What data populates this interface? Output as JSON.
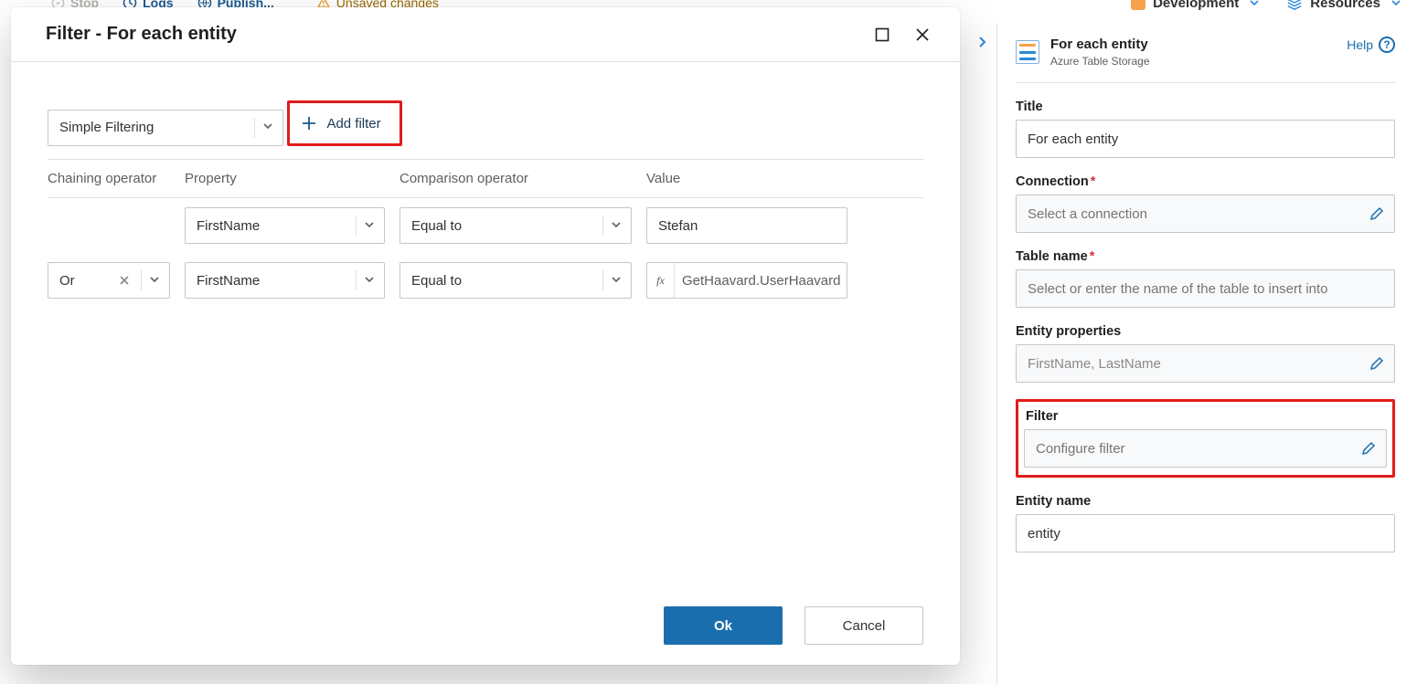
{
  "toolbar": {
    "stop": "Stop",
    "logs": "Logs",
    "publish": "Publish...",
    "unsaved": "Unsaved changes"
  },
  "header": {
    "development": "Development",
    "resources": "Resources"
  },
  "modal": {
    "title": "Filter - For each entity",
    "mode": "Simple Filtering",
    "add_filter": "Add filter",
    "columns": {
      "chain": "Chaining operator",
      "property": "Property",
      "comparison": "Comparison operator",
      "value": "Value"
    },
    "rows": [
      {
        "chain": "",
        "property": "FirstName",
        "comparison": "Equal to",
        "value_type": "text",
        "value": "Stefan"
      },
      {
        "chain": "Or",
        "property": "FirstName",
        "comparison": "Equal to",
        "value_type": "fx",
        "value": "GetHaavard.UserHaavard"
      }
    ],
    "ok": "Ok",
    "cancel": "Cancel"
  },
  "side": {
    "title": "For each entity",
    "subtitle": "Azure Table Storage",
    "help": "Help",
    "fields": {
      "title_label": "Title",
      "title_value": "For each entity",
      "connection_label": "Connection",
      "connection_placeholder": "Select a connection",
      "table_label": "Table name",
      "table_placeholder": "Select or enter the name of the table to insert into",
      "props_label": "Entity properties",
      "props_value": "FirstName, LastName",
      "filter_label": "Filter",
      "filter_placeholder": "Configure filter",
      "entity_label": "Entity name",
      "entity_value": "entity"
    }
  }
}
